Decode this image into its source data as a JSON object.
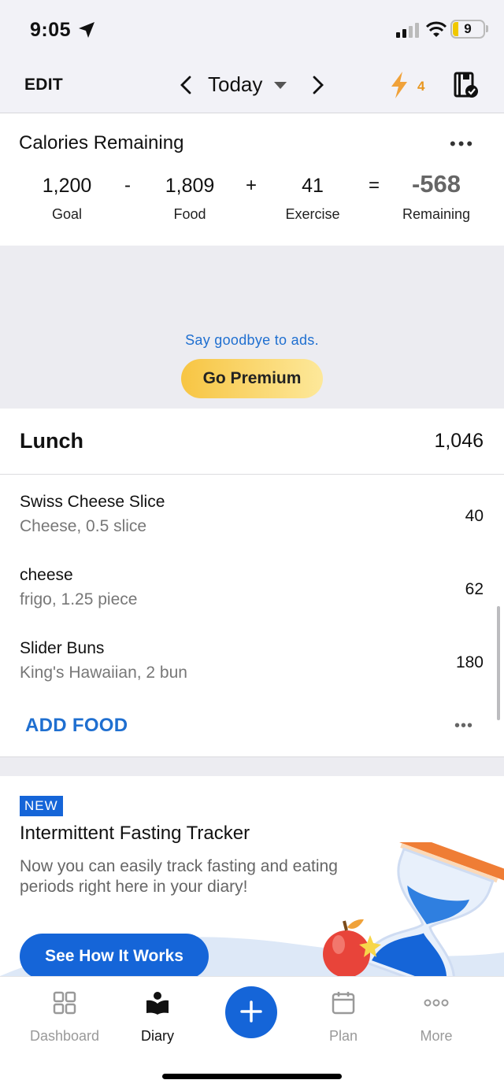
{
  "status_bar": {
    "time": "9:05",
    "battery": "9"
  },
  "header": {
    "edit_label": "EDIT",
    "date_label": "Today",
    "streak_count": "4"
  },
  "calories": {
    "title": "Calories Remaining",
    "goal_value": "1,200",
    "goal_label": "Goal",
    "minus_op": "-",
    "food_value": "1,809",
    "food_label": "Food",
    "plus_op": "+",
    "exercise_value": "41",
    "exercise_label": "Exercise",
    "equals_op": "=",
    "remaining_value": "-568",
    "remaining_label": "Remaining"
  },
  "ad": {
    "text": "Say goodbye to ads.",
    "button_label": "Go Premium"
  },
  "lunch": {
    "title": "Lunch",
    "total": "1,046",
    "items": [
      {
        "name": "Swiss Cheese Slice",
        "desc": "Cheese, 0.5 slice",
        "calories": "40"
      },
      {
        "name": "cheese",
        "desc": "frigo, 1.25 piece",
        "calories": "62"
      },
      {
        "name": "Slider Buns",
        "desc": "King's Hawaiian, 2 bun",
        "calories": "180"
      }
    ],
    "add_food_label": "ADD FOOD"
  },
  "promo": {
    "badge": "NEW",
    "title": "Intermittent Fasting Tracker",
    "text": "Now you can easily track fasting and eating periods right here in your diary!",
    "button_label": "See How It Works"
  },
  "tabs": {
    "dashboard": "Dashboard",
    "diary": "Diary",
    "plan": "Plan",
    "more": "More"
  },
  "colors": {
    "accent": "#1565d8",
    "link": "#1f6fd0",
    "premium": "#f7c543",
    "streak": "#e8961e"
  }
}
